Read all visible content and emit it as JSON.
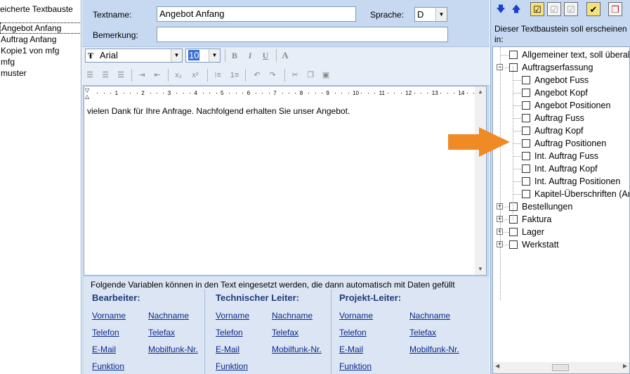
{
  "left_panel": {
    "header": "eicherte Textbauste",
    "items": [
      "Angebot Anfang",
      "Auftrag Anfang",
      "Kopie1 von mfg",
      "mfg",
      "muster"
    ]
  },
  "form": {
    "textname_label": "Textname:",
    "textname_value": "Angebot Anfang",
    "language_label": "Sprache:",
    "language_value": "D",
    "remark_label": "Bemerkung:",
    "remark_value": ""
  },
  "format_toolbar": {
    "font_name": "Arial",
    "font_size": "10",
    "bold": "B",
    "italic": "I",
    "underline": "U",
    "font_color": "A"
  },
  "editor": {
    "ruler_numbers": [
      "1",
      "2",
      "3",
      "4",
      "5",
      "6",
      "7",
      "8",
      "9",
      "10",
      "11",
      "12",
      "13",
      "14"
    ],
    "text": "vielen Dank für Ihre Anfrage. Nachfolgend erhalten Sie unser Angebot."
  },
  "variables": {
    "intro": "Folgende Variablen können in den Text eingesetzt werden, die dann automatisch mit Daten gefüllt",
    "groups": [
      {
        "title": "Bearbeiter:",
        "col1": [
          "Vorname",
          "Telefon",
          "E-Mail",
          "Funktion"
        ],
        "col2": [
          "Nachname",
          "Telefax",
          "Mobilfunk-Nr."
        ]
      },
      {
        "title": "Technischer Leiter:",
        "col1": [
          "Vorname",
          "Telefon",
          "E-Mail",
          "Funktion"
        ],
        "col2": [
          "Nachname",
          "Telefax",
          "Mobilfunk-Nr."
        ]
      },
      {
        "title": "Projekt-Leiter:",
        "col1": [
          "Vorname",
          "Telefon",
          "E-Mail",
          "Funktion"
        ],
        "col2": [
          "Nachname",
          "Telefax",
          "Mobilfunk-Nr."
        ]
      }
    ]
  },
  "right_panel": {
    "label": "Dieser Textbaustein soll erscheinen in:",
    "tree": [
      {
        "label": "Allgemeiner text, soll überal",
        "level": 0,
        "expander": "none"
      },
      {
        "label": "Auftragserfassung",
        "level": 0,
        "expander": "minus"
      },
      {
        "label": "Angebot Fuss",
        "level": 1
      },
      {
        "label": "Angebot Kopf",
        "level": 1
      },
      {
        "label": "Angebot Positionen",
        "level": 1
      },
      {
        "label": "Auftrag Fuss",
        "level": 1
      },
      {
        "label": "Auftrag Kopf",
        "level": 1
      },
      {
        "label": "Auftrag Positionen",
        "level": 1
      },
      {
        "label": "Int. Auftrag Fuss",
        "level": 1
      },
      {
        "label": "Int. Auftrag Kopf",
        "level": 1
      },
      {
        "label": "Int. Auftrag Positionen",
        "level": 1
      },
      {
        "label": "Kapitel-Überschriften (An",
        "level": 1
      },
      {
        "label": "Bestellungen",
        "level": 0,
        "expander": "plus"
      },
      {
        "label": "Faktura",
        "level": 0,
        "expander": "plus"
      },
      {
        "label": "Lager",
        "level": 0,
        "expander": "plus"
      },
      {
        "label": "Werkstatt",
        "level": 0,
        "expander": "plus"
      }
    ]
  },
  "colors": {
    "highlight_arrow": "#f08a24",
    "panel_bg": "#c6d9f1",
    "link": "#0a2a8a"
  }
}
